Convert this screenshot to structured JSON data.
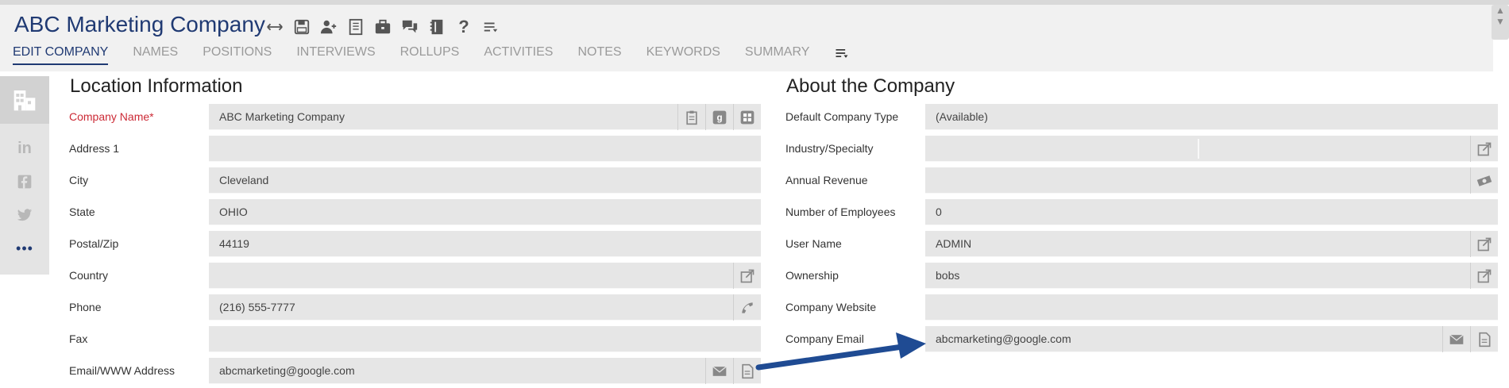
{
  "header": {
    "title": "ABC Marketing Company",
    "toolbar_icons": [
      "expand-arrows-icon",
      "save-icon",
      "add-user-icon",
      "report-icon",
      "briefcase-icon",
      "chat-icon",
      "address-book-icon",
      "help-icon",
      "menu-icon"
    ]
  },
  "tabs": [
    {
      "label": "EDIT COMPANY",
      "active": true
    },
    {
      "label": "NAMES"
    },
    {
      "label": "POSITIONS"
    },
    {
      "label": "INTERVIEWS"
    },
    {
      "label": "ROLLUPS"
    },
    {
      "label": "ACTIVITIES"
    },
    {
      "label": "NOTES"
    },
    {
      "label": "KEYWORDS"
    },
    {
      "label": "SUMMARY"
    }
  ],
  "sidebar": {
    "icons": [
      "building-icon",
      "linkedin-icon",
      "facebook-icon",
      "twitter-icon",
      "more-icon"
    ],
    "more_label": "•••"
  },
  "location": {
    "title": "Location Information",
    "fields": [
      {
        "label": "Company Name*",
        "value": "ABC Marketing Company",
        "required": true,
        "icons": [
          "clipboard-icon",
          "google-icon",
          "windows-icon"
        ]
      },
      {
        "label": "Address 1",
        "value": ""
      },
      {
        "label": "City",
        "value": "Cleveland"
      },
      {
        "label": "State",
        "value": "OHIO"
      },
      {
        "label": "Postal/Zip",
        "value": "44119"
      },
      {
        "label": "Country",
        "value": "",
        "icons": [
          "open-external-icon"
        ]
      },
      {
        "label": "Phone",
        "value": "(216) 555-7777",
        "icons": [
          "phone-icon"
        ]
      },
      {
        "label": "Fax",
        "value": ""
      },
      {
        "label": "Email/WWW Address",
        "value": "abcmarketing@google.com",
        "icons": [
          "mail-icon",
          "document-icon"
        ]
      }
    ]
  },
  "about": {
    "title": "About the Company",
    "fields": [
      {
        "label": "Default Company Type",
        "value": "(Available)"
      },
      {
        "label": "Industry/Specialty",
        "value": "",
        "icons": [
          "open-external-icon"
        ]
      },
      {
        "label": "Annual Revenue",
        "value": "",
        "icons": [
          "money-icon"
        ]
      },
      {
        "label": "Number of Employees",
        "value": "0"
      },
      {
        "label": "User Name",
        "value": "ADMIN",
        "icons": [
          "open-external-icon"
        ]
      },
      {
        "label": "Ownership",
        "value": "bobs",
        "icons": [
          "open-external-icon"
        ]
      },
      {
        "label": "Company Website",
        "value": ""
      },
      {
        "label": "Company Email",
        "value": "abcmarketing@google.com",
        "icons": [
          "mail-icon",
          "document-icon"
        ]
      }
    ]
  },
  "colors": {
    "title": "#203a73",
    "required": "#cc2a36",
    "arrow": "#1f4b93",
    "field_bg": "#e6e6e6"
  }
}
